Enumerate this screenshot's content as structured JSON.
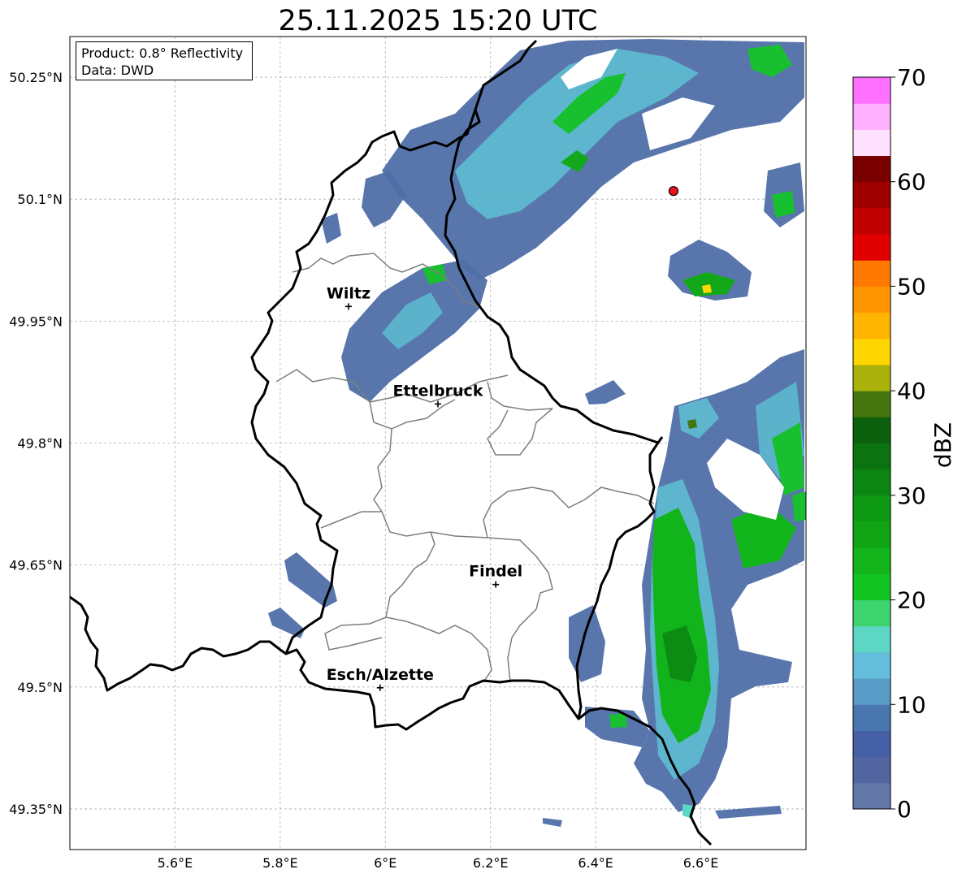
{
  "title": "25.11.2025 15:20 UTC",
  "info_box": {
    "line1": "Product: 0.8° Reflectivity",
    "line2": "Data: DWD"
  },
  "map": {
    "lon_range": [
      5.4,
      6.8
    ],
    "lat_range": [
      49.3,
      50.3
    ],
    "lon_ticks": [
      {
        "value": 5.6,
        "label": "5.6°E"
      },
      {
        "value": 5.8,
        "label": "5.8°E"
      },
      {
        "value": 6.0,
        "label": "6°E"
      },
      {
        "value": 6.2,
        "label": "6.2°E"
      },
      {
        "value": 6.4,
        "label": "6.4°E"
      },
      {
        "value": 6.6,
        "label": "6.6°E"
      }
    ],
    "lat_ticks": [
      {
        "value": 50.25,
        "label": "50.25°N"
      },
      {
        "value": 50.1,
        "label": "50.1°N"
      },
      {
        "value": 49.95,
        "label": "49.95°N"
      },
      {
        "value": 49.8,
        "label": "49.8°N"
      },
      {
        "value": 49.65,
        "label": "49.65°N"
      },
      {
        "value": 49.5,
        "label": "49.5°N"
      },
      {
        "value": 49.35,
        "label": "49.35°N"
      }
    ],
    "cities": [
      {
        "name": "Wiltz",
        "lon": 5.93,
        "lat": 49.968
      },
      {
        "name": "Ettelbruck",
        "lon": 6.1,
        "lat": 49.848
      },
      {
        "name": "Findel",
        "lon": 6.21,
        "lat": 49.626
      },
      {
        "name": "Esch/Alzette",
        "lon": 5.99,
        "lat": 49.499
      }
    ],
    "radar_site": {
      "lon": 6.548,
      "lat": 50.11,
      "color": "#e8141d"
    }
  },
  "colorbar": {
    "label": "dBZ",
    "min": 0,
    "max": 70,
    "step": 2.5,
    "ticks": [
      0,
      10,
      20,
      30,
      40,
      50,
      60,
      70
    ],
    "colors": [
      "#6478a8",
      "#5265a0",
      "#4560a6",
      "#4a76b0",
      "#5a9cc8",
      "#65bedb",
      "#5dd6c4",
      "#3ed470",
      "#12c520",
      "#13b41c",
      "#11a516",
      "#0f9a14",
      "#0c8612",
      "#0b7410",
      "#0a600c",
      "#467510",
      "#aab10a",
      "#ffd600",
      "#ffb400",
      "#ff9600",
      "#ff7800",
      "#e00000",
      "#c00000",
      "#9e0000",
      "#7a0000",
      "#ffe0ff",
      "#ffb0ff",
      "#ff70ff",
      "#ec32ec"
    ]
  }
}
